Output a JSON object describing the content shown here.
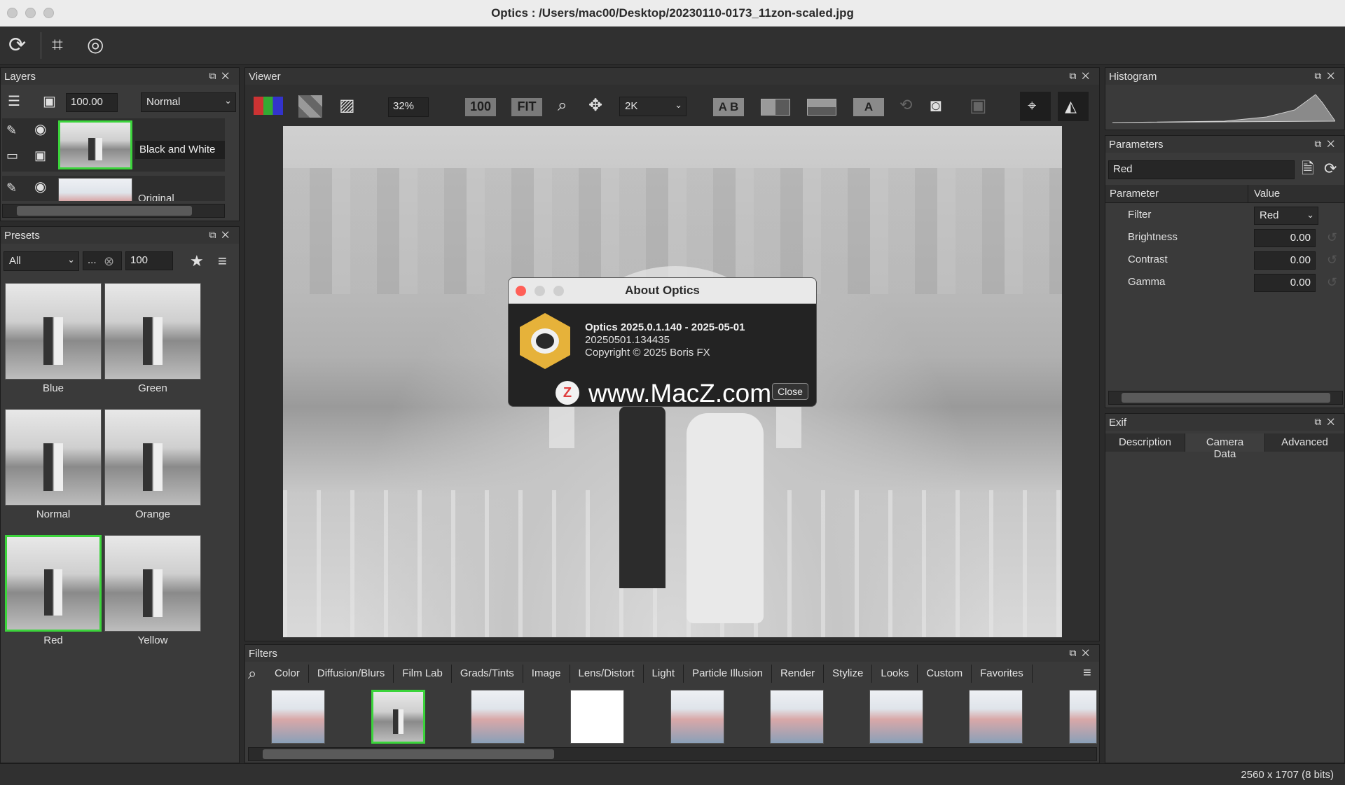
{
  "window": {
    "title": "Optics : /Users/mac00/Desktop/20230110-0173_11zon-scaled.jpg"
  },
  "toolbar": {
    "icons": [
      "refresh-icon",
      "crop-icon",
      "rotate-icon"
    ]
  },
  "layers": {
    "title": "Layers",
    "opacity": "100.00",
    "blend_mode": "Normal",
    "items": [
      {
        "name": "Black and White"
      },
      {
        "name": "Original"
      }
    ]
  },
  "presets": {
    "title": "Presets",
    "category": "All",
    "search": "...",
    "size": "100",
    "items": [
      {
        "label": "Blue"
      },
      {
        "label": "Green"
      },
      {
        "label": "Normal"
      },
      {
        "label": "Orange"
      },
      {
        "label": "Red"
      },
      {
        "label": "Yellow"
      }
    ],
    "selected": "Red"
  },
  "viewer": {
    "title": "Viewer",
    "zoom": "32%",
    "btn_100": "100",
    "btn_fit": "FIT",
    "resolution": "2K",
    "ab_label": "A B"
  },
  "about": {
    "title": "About Optics",
    "version": "Optics 2025.0.1.140 - 2025-05-01",
    "build": "20250501.134435",
    "copyright": "Copyright © 2025 Boris FX",
    "close": "Close",
    "watermark": "www.MacZ.com"
  },
  "filters": {
    "title": "Filters",
    "tabs": [
      "Color",
      "Diffusion/Blurs",
      "Film Lab",
      "Grads/Tints",
      "Image",
      "Lens/Distort",
      "Light",
      "Particle Illusion",
      "Render",
      "Stylize",
      "Looks",
      "Custom",
      "Favorites"
    ]
  },
  "histogram": {
    "title": "Histogram"
  },
  "parameters": {
    "title": "Parameters",
    "preset_name": "Red",
    "col_param": "Parameter",
    "col_value": "Value",
    "filter_label": "Filter",
    "filter_value": "Red",
    "rows": [
      {
        "name": "Brightness",
        "value": "0.00"
      },
      {
        "name": "Contrast",
        "value": "0.00"
      },
      {
        "name": "Gamma",
        "value": "0.00"
      }
    ]
  },
  "exif": {
    "title": "Exif",
    "tabs": [
      "Description",
      "Camera Data",
      "Advanced"
    ]
  },
  "status": {
    "text": "2560 x 1707 (8 bits)"
  }
}
